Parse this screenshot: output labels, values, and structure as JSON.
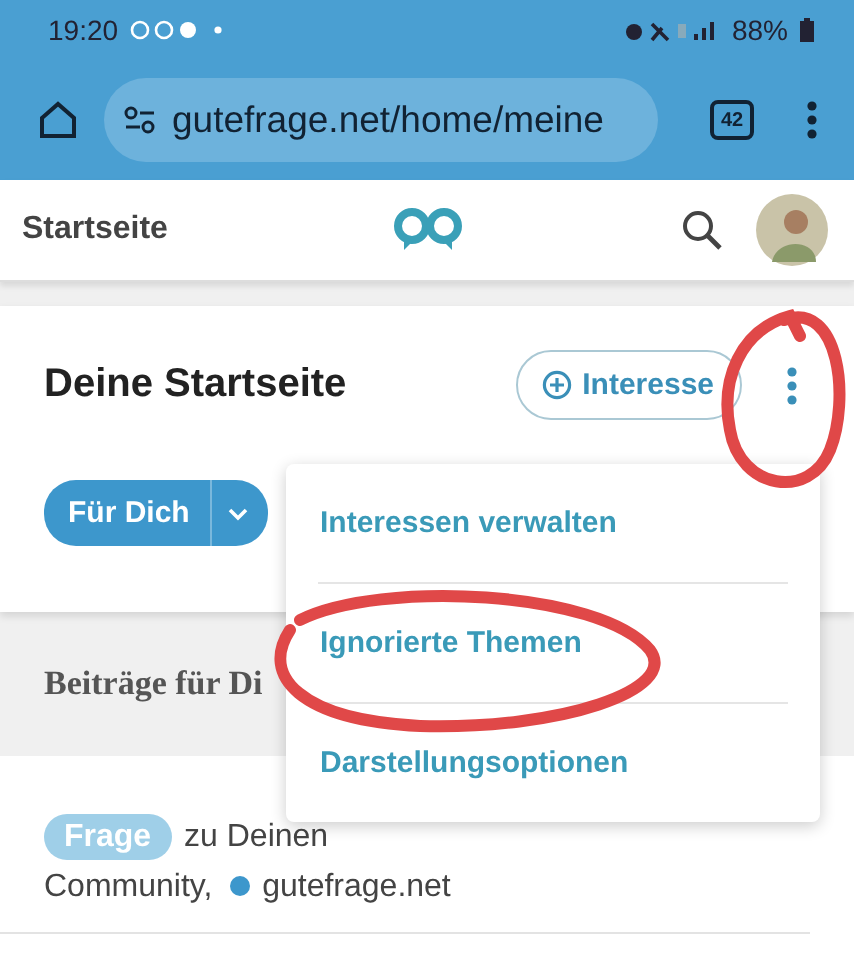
{
  "status_bar": {
    "time": "19:20",
    "battery": "88%"
  },
  "browser": {
    "url": "gutefrage.net/home/meine",
    "tab_count": "42"
  },
  "header": {
    "title": "Startseite"
  },
  "card": {
    "title": "Deine Startseite",
    "add_button": "Interesse",
    "feed_button": "Für Dich"
  },
  "section": {
    "title": "Beiträge für Di"
  },
  "post": {
    "tag": "Frage",
    "text": "zu Deinen",
    "topics": [
      "Community,",
      "gutefrage.net"
    ]
  },
  "menu": {
    "items": [
      {
        "label": "Interessen verwalten"
      },
      {
        "label": "Ignorierte Themen"
      },
      {
        "label": "Darstellungsoptionen"
      }
    ]
  },
  "annotations": [
    {
      "kind": "circle"
    },
    {
      "kind": "circle"
    }
  ]
}
